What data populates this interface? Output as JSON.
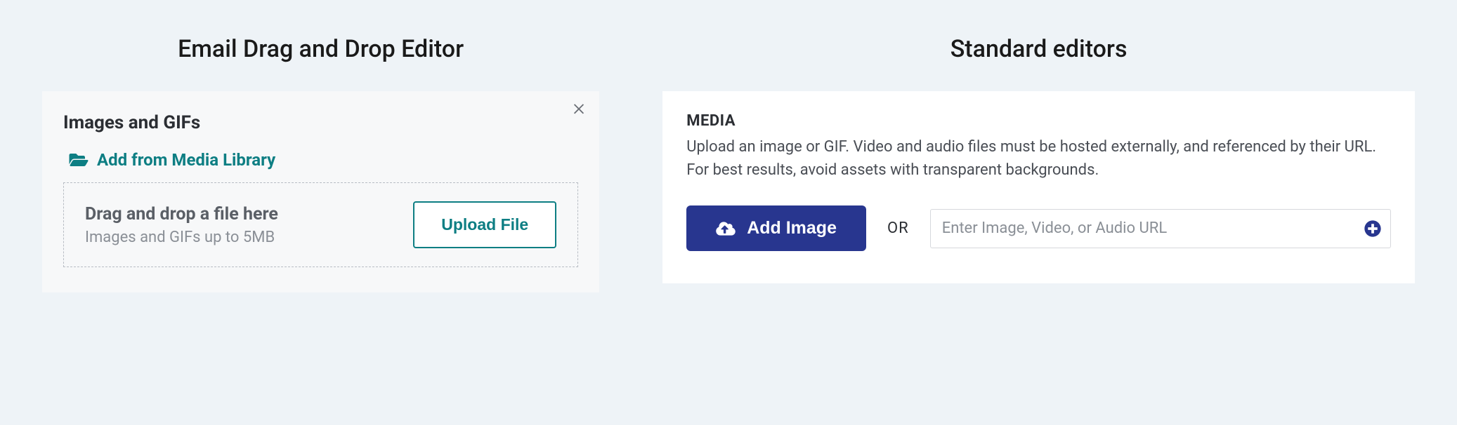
{
  "left": {
    "title": "Email Drag and Drop Editor",
    "panel_subtitle": "Images and GIFs",
    "media_library_link": "Add from Media Library",
    "drop_title": "Drag and drop a file here",
    "drop_sub": "Images and GIFs up to 5MB",
    "upload_button": "Upload File"
  },
  "right": {
    "title": "Standard editors",
    "media_header": "MEDIA",
    "media_desc": "Upload an image or GIF. Video and audio files must be hosted externally, and referenced by their URL. For best results, avoid assets with transparent backgrounds.",
    "add_image_button": "Add Image",
    "or_label": "OR",
    "url_placeholder": "Enter Image, Video, or Audio URL"
  }
}
